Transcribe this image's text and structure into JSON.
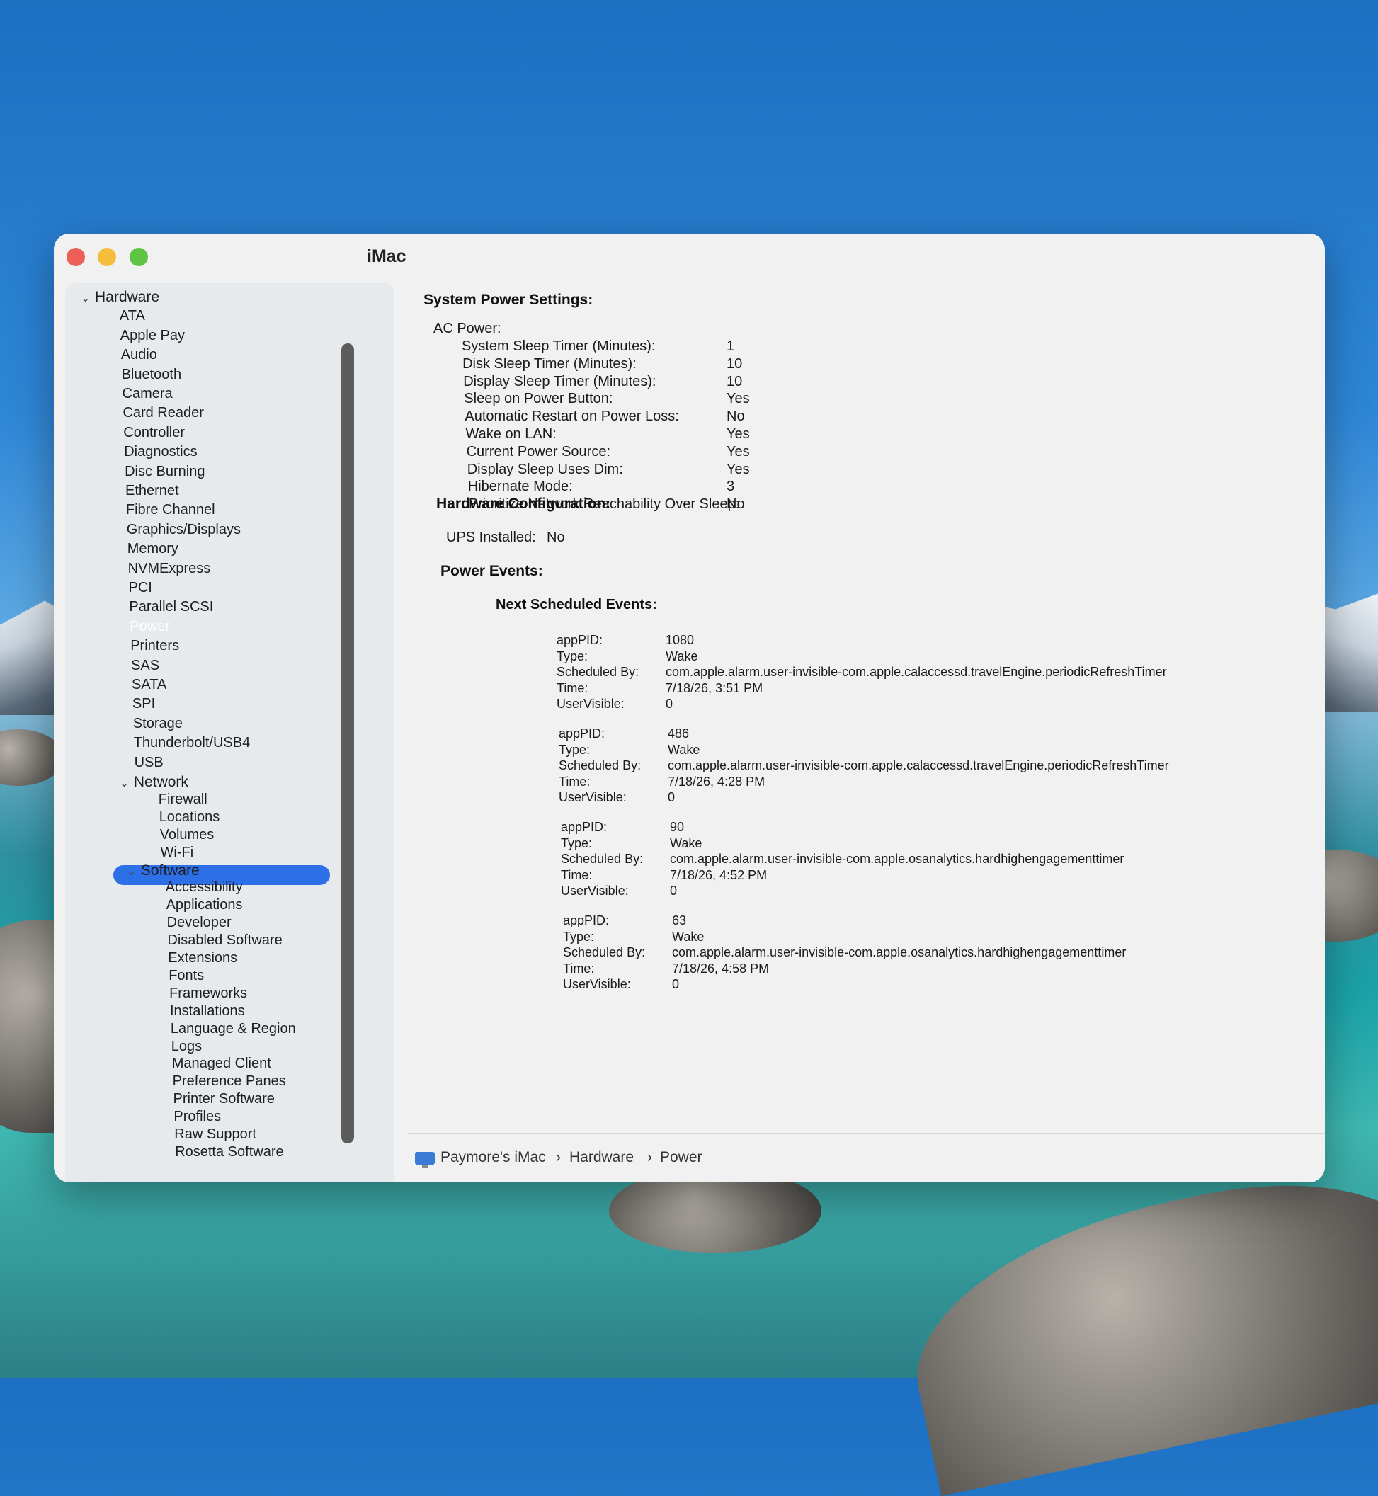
{
  "window": {
    "title": "iMac"
  },
  "sidebar": {
    "hardware": {
      "label": "Hardware",
      "items": [
        "ATA",
        "Apple Pay",
        "Audio",
        "Bluetooth",
        "Camera",
        "Card Reader",
        "Controller",
        "Diagnostics",
        "Disc Burning",
        "Ethernet",
        "Fibre Channel",
        "Graphics/Displays",
        "Memory",
        "NVMExpress",
        "PCI",
        "Parallel SCSI",
        "Power",
        "Printers",
        "SAS",
        "SATA",
        "SPI",
        "Storage",
        "Thunderbolt/USB4",
        "USB"
      ]
    },
    "network": {
      "label": "Network",
      "items": [
        "Firewall",
        "Locations",
        "Volumes",
        "Wi-Fi"
      ]
    },
    "software": {
      "label": "Software",
      "items": [
        "Accessibility",
        "Applications",
        "Developer",
        "Disabled Software",
        "Extensions",
        "Fonts",
        "Frameworks",
        "Installations",
        "Language & Region",
        "Logs",
        "Managed Client",
        "Preference Panes",
        "Printer Software",
        "Profiles",
        "Raw Support",
        "Rosetta Software"
      ]
    },
    "selected": "Power"
  },
  "content": {
    "system_power_heading": "System Power Settings:",
    "ac_power_label": "AC Power:",
    "ac_settings": [
      {
        "label": "System Sleep Timer (Minutes):",
        "value": "1"
      },
      {
        "label": "Disk Sleep Timer (Minutes):",
        "value": "10"
      },
      {
        "label": "Display Sleep Timer (Minutes):",
        "value": "10"
      },
      {
        "label": "Sleep on Power Button:",
        "value": "Yes"
      },
      {
        "label": "Automatic Restart on Power Loss:",
        "value": "No"
      },
      {
        "label": "Wake on LAN:",
        "value": "Yes"
      },
      {
        "label": "Current Power Source:",
        "value": "Yes"
      },
      {
        "label": "Display Sleep Uses Dim:",
        "value": "Yes"
      },
      {
        "label": "Hibernate Mode:",
        "value": "3"
      },
      {
        "label": "Prioritize Network Reachability Over Sleep:",
        "value": "No"
      }
    ],
    "hardware_config_heading": "Hardware Configuration:",
    "ups_label": "UPS Installed:",
    "ups_value": "No",
    "power_events_heading": "Power Events:",
    "next_events_heading": "Next Scheduled Events:",
    "event_field_labels": [
      "appPID:",
      "Type:",
      "Scheduled By:",
      "Time:",
      "UserVisible:"
    ],
    "events": [
      {
        "appPID": "1080",
        "type": "Wake",
        "scheduled_by": "com.apple.alarm.user-invisible-com.apple.calaccessd.travelEngine.periodicRefreshTimer",
        "time": "7/18/26, 3:51 PM",
        "user_visible": "0"
      },
      {
        "appPID": "486",
        "type": "Wake",
        "scheduled_by": "com.apple.alarm.user-invisible-com.apple.calaccessd.travelEngine.periodicRefreshTimer",
        "time": "7/18/26, 4:28 PM",
        "user_visible": "0"
      },
      {
        "appPID": "90",
        "type": "Wake",
        "scheduled_by": "com.apple.alarm.user-invisible-com.apple.osanalytics.hardhighengagementtimer",
        "time": "7/18/26, 4:52 PM",
        "user_visible": "0"
      },
      {
        "appPID": "63",
        "type": "Wake",
        "scheduled_by": "com.apple.alarm.user-invisible-com.apple.osanalytics.hardhighengagementtimer",
        "time": "7/18/26, 4:58 PM",
        "user_visible": "0"
      }
    ]
  },
  "pathbar": {
    "computer": "Paymore's iMac",
    "section": "Hardware",
    "item": "Power",
    "separator": "›"
  }
}
